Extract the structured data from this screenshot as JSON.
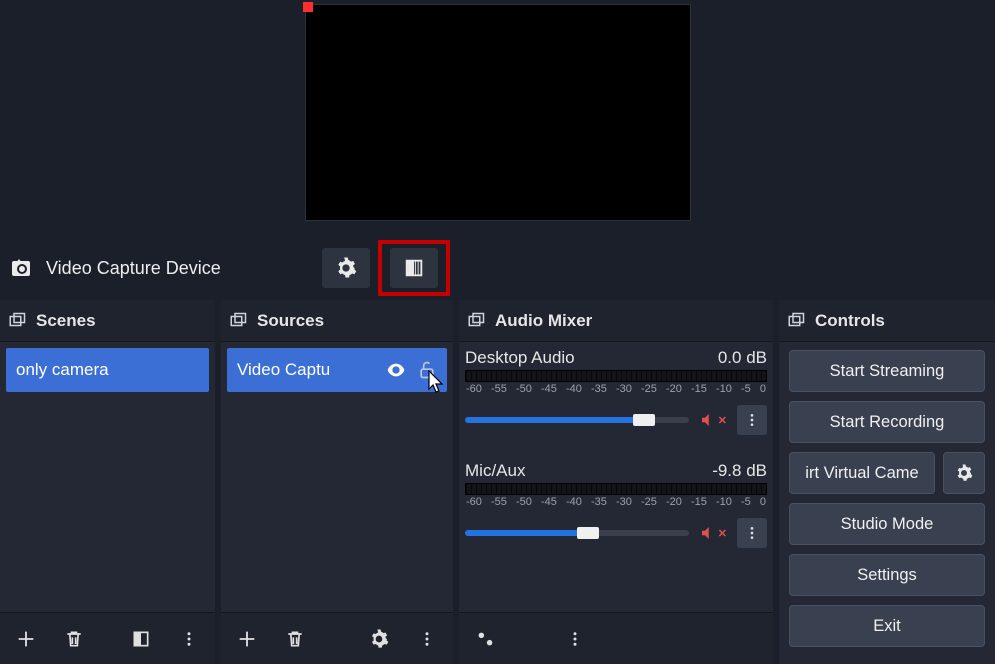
{
  "toolbar": {
    "source_label": "Video Capture Device"
  },
  "panels": {
    "scenes_title": "Scenes",
    "sources_title": "Sources",
    "mixer_title": "Audio Mixer",
    "controls_title": "Controls"
  },
  "scenes": {
    "items": [
      {
        "name": "only camera"
      }
    ]
  },
  "sources": {
    "items": [
      {
        "name": "Video Captu"
      }
    ]
  },
  "mixer": {
    "tick_labels": [
      "-60",
      "-55",
      "-50",
      "-45",
      "-40",
      "-35",
      "-30",
      "-25",
      "-20",
      "-15",
      "-10",
      "-5",
      "0"
    ],
    "channels": [
      {
        "name": "Desktop Audio",
        "db": "0.0 dB",
        "level_pct": 0,
        "vol_pct": 80,
        "muted": true
      },
      {
        "name": "Mic/Aux",
        "db": "-9.8 dB",
        "level_pct": 0,
        "vol_pct": 55,
        "muted": true
      }
    ]
  },
  "controls": {
    "start_streaming": "Start Streaming",
    "start_recording": "Start Recording",
    "virtual_cam": "irt Virtual Came",
    "studio_mode": "Studio Mode",
    "settings": "Settings",
    "exit": "Exit"
  }
}
